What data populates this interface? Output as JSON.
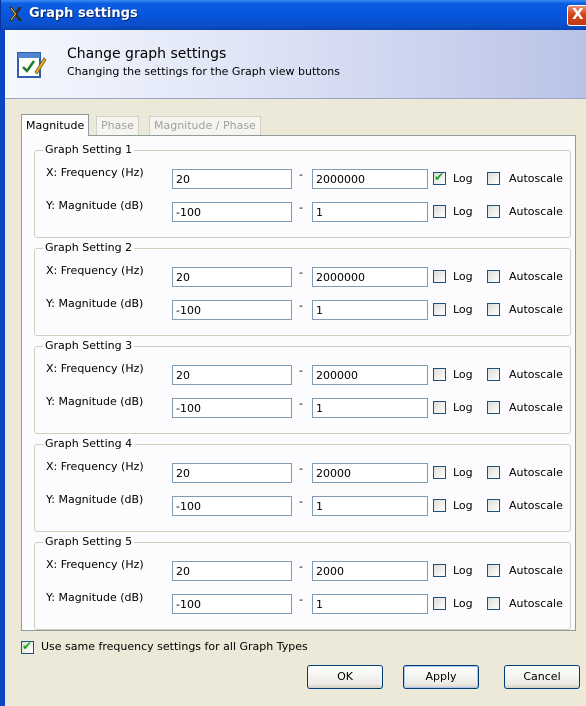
{
  "window": {
    "title": "Graph settings",
    "close_glyph": "X",
    "title_icon": "x-logo-icon"
  },
  "banner": {
    "title": "Change graph settings",
    "subtitle": "Changing the settings for the Graph view buttons",
    "icon": "checklist-pen-icon"
  },
  "tabs": [
    {
      "label": "Magnitude",
      "active": true
    },
    {
      "label": "Phase",
      "active": false
    },
    {
      "label": "Magnitude / Phase",
      "active": false
    }
  ],
  "labels": {
    "x_axis": "X: Frequency (Hz)",
    "y_axis": "Y: Magnitude (dB)",
    "dash": "-",
    "log": "Log",
    "autoscale": "Autoscale"
  },
  "groups": [
    {
      "title": "Graph Setting 1",
      "x": {
        "min": "20",
        "max": "2000000",
        "log": true,
        "autoscale": false
      },
      "y": {
        "min": "-100",
        "max": "1",
        "log": false,
        "autoscale": false
      }
    },
    {
      "title": "Graph Setting 2",
      "x": {
        "min": "20",
        "max": "2000000",
        "log": false,
        "autoscale": false
      },
      "y": {
        "min": "-100",
        "max": "1",
        "log": false,
        "autoscale": false
      }
    },
    {
      "title": "Graph Setting 3",
      "x": {
        "min": "20",
        "max": "200000",
        "log": false,
        "autoscale": false
      },
      "y": {
        "min": "-100",
        "max": "1",
        "log": false,
        "autoscale": false
      }
    },
    {
      "title": "Graph Setting 4",
      "x": {
        "min": "20",
        "max": "20000",
        "log": false,
        "autoscale": false
      },
      "y": {
        "min": "-100",
        "max": "1",
        "log": false,
        "autoscale": false
      }
    },
    {
      "title": "Graph Setting 5",
      "x": {
        "min": "20",
        "max": "2000",
        "log": false,
        "autoscale": false
      },
      "y": {
        "min": "-100",
        "max": "1",
        "log": false,
        "autoscale": false
      }
    }
  ],
  "same_frequency": {
    "label": "Use same frequency settings for all Graph Types",
    "checked": true
  },
  "buttons": {
    "ok": "OK",
    "apply": "Apply",
    "cancel": "Cancel"
  },
  "colors": {
    "titlebar": "#0855dd",
    "close": "#d2451b",
    "check": "#21a121"
  }
}
